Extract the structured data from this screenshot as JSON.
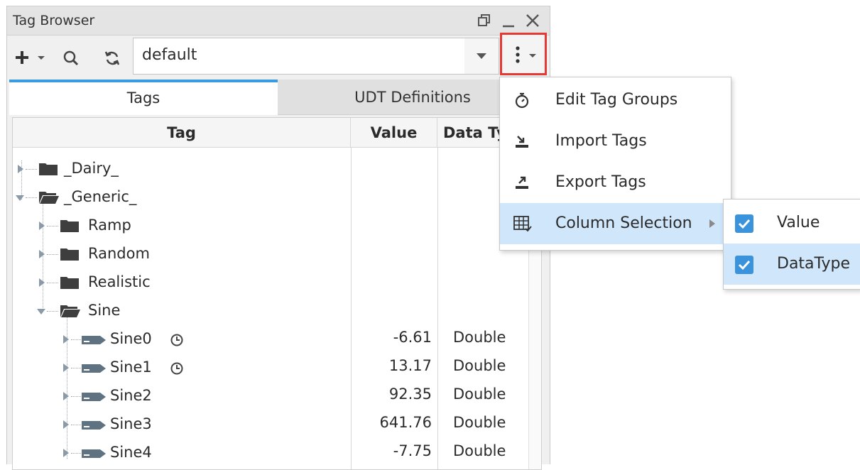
{
  "window": {
    "title": "Tag Browser"
  },
  "toolbar": {
    "provider_value": "default"
  },
  "tabs": [
    "Tags",
    "UDT Definitions"
  ],
  "columns": {
    "tag": "Tag",
    "value": "Value",
    "datatype": "Data Ty"
  },
  "tree": {
    "dairy": "_Dairy_",
    "generic": "_Generic_",
    "ramp": "Ramp",
    "random": "Random",
    "realistic": "Realistic",
    "sine": "Sine",
    "tags": [
      {
        "name": "Sine0",
        "value": "-6.61",
        "type": "Double"
      },
      {
        "name": "Sine1",
        "value": "13.17",
        "type": "Double"
      },
      {
        "name": "Sine2",
        "value": "92.35",
        "type": "Double"
      },
      {
        "name": "Sine3",
        "value": "641.76",
        "type": "Double"
      },
      {
        "name": "Sine4",
        "value": "-7.75",
        "type": "Double"
      }
    ]
  },
  "menu": {
    "edit_tag_groups": "Edit Tag Groups",
    "import_tags": "Import Tags",
    "export_tags": "Export Tags",
    "column_selection": "Column Selection"
  },
  "submenu": {
    "value": "Value",
    "datatype": "DataType"
  },
  "colors": {
    "accent": "#3a9be0",
    "highlight": "#cfe6fb",
    "checkbox": "#3b93db",
    "outline": "#e53935"
  }
}
